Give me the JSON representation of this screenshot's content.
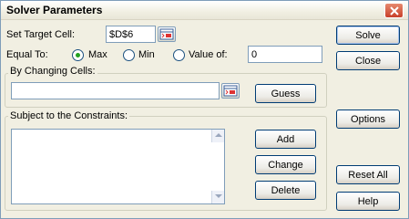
{
  "window": {
    "title": "Solver Parameters",
    "close_glyph": "✕"
  },
  "target": {
    "label": "Set Target Cell:",
    "value": "$D$6"
  },
  "equal_to": {
    "label": "Equal To:",
    "options": [
      {
        "label": "Max",
        "selected": true
      },
      {
        "label": "Min",
        "selected": false
      },
      {
        "label": "Value of:",
        "selected": false
      }
    ],
    "value_of": "0"
  },
  "changing_cells": {
    "label": "By Changing Cells:",
    "value": "",
    "guess_label": "Guess"
  },
  "constraints": {
    "label": "Subject to the Constraints:",
    "items": [],
    "add_label": "Add",
    "change_label": "Change",
    "delete_label": "Delete"
  },
  "buttons": {
    "solve": "Solve",
    "close": "Close",
    "options": "Options",
    "reset_all": "Reset All",
    "help": "Help"
  },
  "colors": {
    "selected_radio_dot": "#21a121",
    "close_button": "#c8402a",
    "field_border": "#7f9db9"
  }
}
